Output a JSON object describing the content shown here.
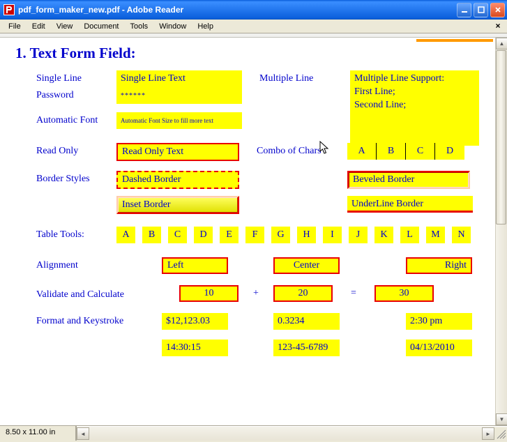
{
  "window": {
    "title": "pdf_form_maker_new.pdf - Adobe Reader"
  },
  "menu": {
    "items": [
      "File",
      "Edit",
      "View",
      "Document",
      "Tools",
      "Window",
      "Help"
    ]
  },
  "heading": "1. Text Form Field:",
  "labels": {
    "single_line": "Single Line",
    "multiple_line": "Multiple Line",
    "password": "Password",
    "automatic_font": "Automatic Font",
    "read_only": "Read Only",
    "combo_chars": "Combo of Chars",
    "border_styles": "Border Styles",
    "table_tools": "Table Tools:",
    "alignment": "Alignment",
    "validate_calc": "Validate and Calculate",
    "format_key": "Format and Keystroke"
  },
  "fields": {
    "single_line": "Single Line Text",
    "multiple_line": "Multiple Line Support:\nFirst Line;\nSecond Line;",
    "password": "******",
    "automatic_font": "Automatic Font Size to fill more text",
    "read_only": "Read Only Text",
    "combo_chars": [
      "A",
      "B",
      "C",
      "D"
    ],
    "dashed_border": "Dashed Border",
    "beveled_border": "Beveled Border",
    "inset_border": "Inset Border",
    "underline_border": "UnderLine Border",
    "table_letters": [
      "A",
      "B",
      "C",
      "D",
      "E",
      "F",
      "G",
      "H",
      "I",
      "J",
      "K",
      "L",
      "M",
      "N"
    ],
    "align_left": "Left",
    "align_center": "Center",
    "align_right": "Right",
    "calc_a": "10",
    "calc_op1": "+",
    "calc_b": "20",
    "calc_op2": "=",
    "calc_c": "30",
    "fmt_money": "$12,123.03",
    "fmt_dec": "0.3234",
    "fmt_time12": "2:30 pm",
    "fmt_time24": "14:30:15",
    "fmt_ssn": "123-45-6789",
    "fmt_date": "04/13/2010"
  },
  "statusbar": {
    "dimensions": "8.50 x 11.00 in"
  }
}
